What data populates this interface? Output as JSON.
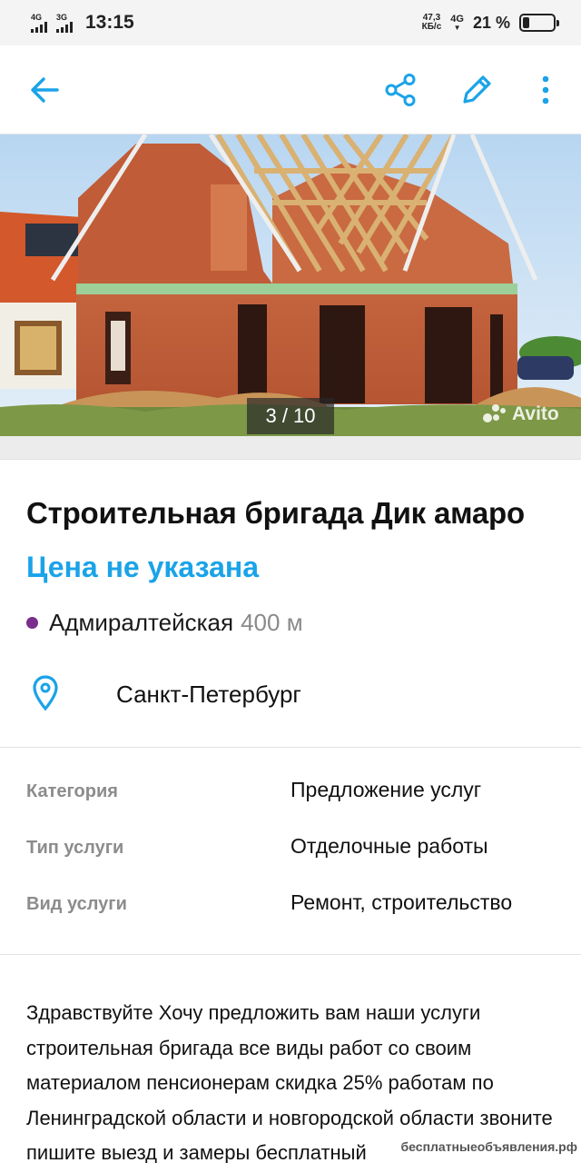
{
  "status_bar": {
    "sim1_net": "4G",
    "sim2_net": "3G",
    "time": "13:15",
    "speed_value": "47,3",
    "speed_unit": "КБ/с",
    "net_type": "4G",
    "battery_percent_label": "21 %",
    "battery_level": 0.21
  },
  "toolbar": {
    "back_icon": "arrow-left-icon",
    "share_icon": "share-icon",
    "edit_icon": "pencil-icon",
    "more_icon": "more-vertical-icon",
    "accent_color": "#1aa3e8"
  },
  "gallery": {
    "counter": "3 / 10",
    "watermark": "Avito"
  },
  "listing": {
    "title": "Строительная бригада Дик амаро",
    "price": "Цена не указана",
    "metro_station": "Адмиралтейская",
    "metro_distance": "400 м",
    "metro_color": "#7b2d8e",
    "city": "Санкт-Петербург"
  },
  "params": [
    {
      "key": "Категория",
      "value": "Предложение услуг"
    },
    {
      "key": "Тип услуги",
      "value": "Отделочные работы"
    },
    {
      "key": "Вид услуги",
      "value": "Ремонт, строительство"
    }
  ],
  "description": "Здравствуйте Хочу предложить вам наши услуги строительная бригада все виды работ со своим материалом  пенсионерам скидка 25% работам по Ленинградской области и новгородской области звоните пишите выезд и замеры бесплатный",
  "site_watermark": "бесплатныеобъявления.рф"
}
